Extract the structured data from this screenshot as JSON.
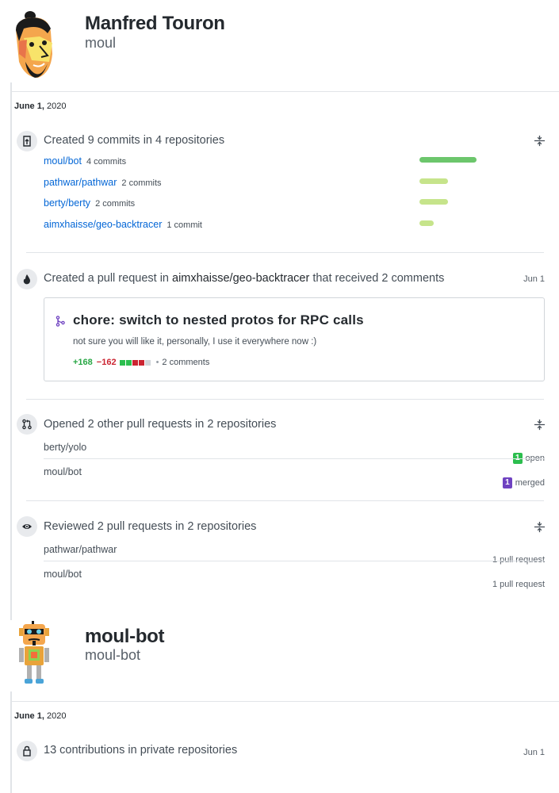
{
  "user1": {
    "display_name": "Manfred Touron",
    "username": "moul",
    "date_bold": "June 1,",
    "date_rest": " 2020",
    "commits_event": {
      "title": "Created 9 commits in 4 repositories",
      "repos": [
        {
          "name": "moul/bot",
          "count": "4 commits",
          "bar_fraction": 1.0,
          "bar_color": "#6cc66c"
        },
        {
          "name": "pathwar/pathwar",
          "count": "2 commits",
          "bar_fraction": 0.5,
          "bar_color": "#c6e48b"
        },
        {
          "name": "berty/berty",
          "count": "2 commits",
          "bar_fraction": 0.5,
          "bar_color": "#c6e48b"
        },
        {
          "name": "aimxhaisse/geo-backtracer",
          "count": "1 commit",
          "bar_fraction": 0.25,
          "bar_color": "#c6e48b"
        }
      ]
    },
    "pr_event": {
      "title_prefix": "Created a pull request in ",
      "title_repo": "aimxhaisse/geo-backtracer",
      "title_suffix": " that received 2 comments",
      "date": "Jun 1",
      "pr_title": "chore: switch to nested protos for RPC calls",
      "pr_body": "not sure you will like it, personally, I use it everywhere now :)",
      "additions": "+168",
      "deletions": "−162",
      "diffstat_colors": [
        "#2cbe4e",
        "#2cbe4e",
        "#cb2431",
        "#cb2431",
        "#d1d5da"
      ],
      "comments": "2 comments",
      "dot": "•"
    },
    "opened_event": {
      "title": "Opened 2 other pull requests in 2 repositories",
      "rows": [
        {
          "repo": "berty/yolo",
          "count": "1",
          "status": "open",
          "color": "#2cbe4e"
        },
        {
          "repo": "moul/bot",
          "count": "1",
          "status": "merged",
          "color": "#6f42c1"
        }
      ]
    },
    "reviewed_event": {
      "title": "Reviewed 2 pull requests in 2 repositories",
      "rows": [
        {
          "repo": "pathwar/pathwar",
          "detail": "1 pull request"
        },
        {
          "repo": "moul/bot",
          "detail": "1 pull request"
        }
      ]
    }
  },
  "user2": {
    "display_name": "moul-bot",
    "username": "moul-bot",
    "date_bold": "June 1,",
    "date_rest": " 2020",
    "private_event": {
      "title": "13 contributions in private repositories",
      "date": "Jun 1"
    }
  }
}
